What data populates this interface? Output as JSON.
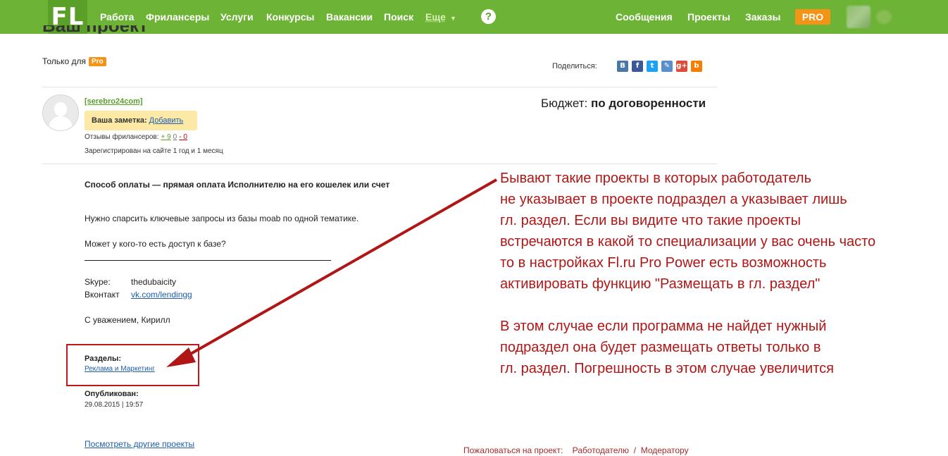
{
  "nav": {
    "logo": "FL",
    "items": [
      "Работа",
      "Фрилансеры",
      "Услуги",
      "Конкурсы",
      "Вакансии",
      "Поиск"
    ],
    "more": "Еще",
    "help": "?",
    "right_items": [
      "Сообщения",
      "Проекты",
      "Заказы"
    ],
    "pro": "PRO"
  },
  "page": {
    "title_cut": "Ваш проект",
    "only_for": "Только для",
    "only_for_badge": "Pro",
    "share_label": "Поделиться:",
    "share_icons": [
      "В",
      "f",
      "t",
      "✎",
      "g+",
      "b"
    ]
  },
  "user": {
    "username": "[serebro24com]",
    "note_label": "Ваша заметка:",
    "note_add": "Добавить",
    "reviews_label": "Отзывы фрилансеров:",
    "reviews_pos": "+ 9",
    "reviews_neu": "0",
    "reviews_neg": "- 0",
    "registered": "Зарегистрирован на сайте 1 год и 1 месяц"
  },
  "budget": {
    "label": "Бюджет:",
    "value": "по договоренности"
  },
  "project": {
    "payment": "Способ оплаты — прямая оплата Исполнителю на его кошелек или счет",
    "line1": "Нужно спарсить ключевые запросы из базы moab по одной тематике.",
    "line2": "Может у кого-то есть доступ к базе?",
    "skype_label": "Skype:",
    "skype_value": "thedubaicity",
    "vk_label": "Вконтакт",
    "vk_value": "vk.com/lendingg",
    "signature": "С уважением, Кирилл",
    "sections_label": "Разделы:",
    "sections_value": "Реклама и Маркетинг",
    "published_label": "Опубликован:",
    "published_value": "29.08.2015 | 19:57",
    "other_projects": "Посмотреть другие проекты",
    "complain_label": "Пожаловаться на проект:",
    "complain_employer": "Работодателю",
    "complain_sep": "/",
    "complain_moderator": "Модератору"
  },
  "annotation": {
    "lines": [
      "Бывают такие проекты в которых работодатель",
      "не указывает в проекте подраздел а указывает лишь",
      "гл. раздел. Если вы видите что такие проекты",
      "встречаются в какой то специализации у вас очень часто",
      "то в настройках Fl.ru Pro Power есть возможность",
      "активировать функцию \"Размещать в гл. раздел\"",
      "В этом случае если программа не найдет нужный",
      "подраздел она будет размещать ответы только в",
      "гл. раздел. Погрешность в этом случае увеличится"
    ]
  },
  "colors": {
    "topbar": "#6db335",
    "pro": "#f39416",
    "annotation": "#b01616",
    "link": "#1f5ea8"
  }
}
